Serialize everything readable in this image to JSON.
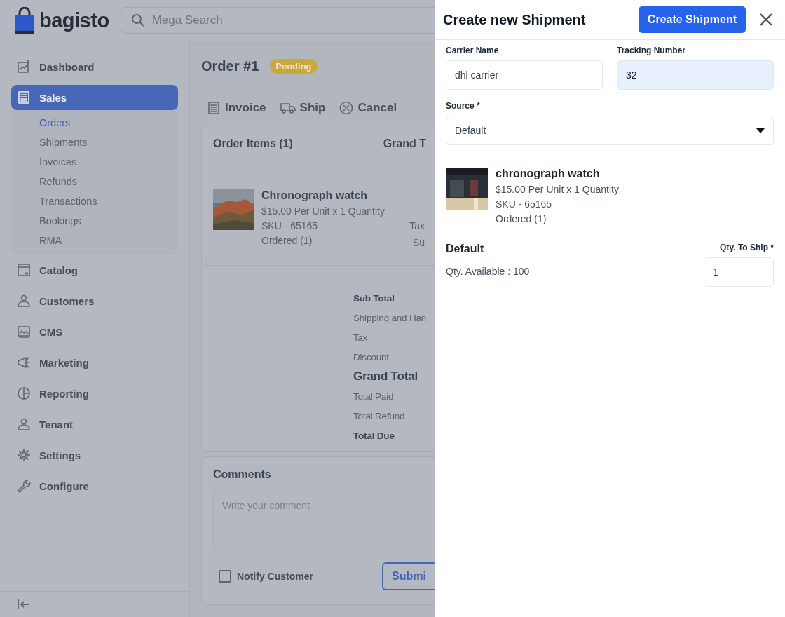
{
  "header": {
    "logo": "bagisto",
    "search": {
      "placeholder": "Mega Search"
    }
  },
  "sidebar": {
    "items": [
      {
        "label": "Dashboard",
        "selected": false
      },
      {
        "label": "Sales",
        "selected": true,
        "expanded": true,
        "children": [
          {
            "label": "Orders",
            "selected": true
          },
          {
            "label": "Shipments",
            "selected": false
          },
          {
            "label": "Invoices",
            "selected": false
          },
          {
            "label": "Refunds",
            "selected": false
          },
          {
            "label": "Transactions",
            "selected": false
          },
          {
            "label": "Bookings",
            "selected": false
          },
          {
            "label": "RMA",
            "selected": false
          }
        ]
      },
      {
        "label": "Catalog",
        "selected": false
      },
      {
        "label": "Customers",
        "selected": false
      },
      {
        "label": "CMS",
        "selected": false
      },
      {
        "label": "Marketing",
        "selected": false
      },
      {
        "label": "Reporting",
        "selected": false
      },
      {
        "label": "Tenant",
        "selected": false
      },
      {
        "label": "Settings",
        "selected": false
      },
      {
        "label": "Configure",
        "selected": false
      }
    ]
  },
  "order": {
    "title": "Order #1",
    "status": "Pending",
    "actions": [
      {
        "label": "Invoice"
      },
      {
        "label": "Ship"
      },
      {
        "label": "Cancel"
      }
    ],
    "items_card": {
      "title": "Order Items (1)",
      "grand_total_heading": "Grand T",
      "item": {
        "name": "Chronograph watch",
        "price": "$15.00 Per Unit x 1 Quantity",
        "sku": "SKU - 65165",
        "ordered": "Ordered (1)"
      },
      "side_labels": [
        "Tax",
        "Su"
      ]
    },
    "totals": [
      {
        "label": "Sub Total",
        "kind": "bold"
      },
      {
        "label": "Shipping and Han",
        "kind": "plain"
      },
      {
        "label": "Tax",
        "kind": "plain"
      },
      {
        "label": "Discount",
        "kind": "plain"
      },
      {
        "label": "Grand Total",
        "kind": "large"
      },
      {
        "label": "Total Paid",
        "kind": "plain"
      },
      {
        "label": "Total Refund",
        "kind": "plain"
      },
      {
        "label": "Total Due",
        "kind": "bold"
      }
    ],
    "comments": {
      "title": "Comments",
      "placeholder": "Write your comment",
      "notify": {
        "label": "Notify Customer",
        "checked": false
      },
      "submit": "Submi"
    }
  },
  "shipment_panel": {
    "title": "Create new Shipment",
    "create_button": "Create Shipment",
    "fields": [
      {
        "label": "Carrier Name",
        "value": "dhl carrier",
        "autofilled": false
      },
      {
        "label": "Tracking Number",
        "value": "32",
        "autofilled": true
      }
    ],
    "source": {
      "label": "Source *",
      "value": "Default"
    },
    "item": {
      "name": "chronograph watch",
      "price": "$15.00 Per Unit x 1 Quantity",
      "sku": "SKU - 65165",
      "ordered": "Ordered (1)"
    },
    "inventory": {
      "source_name": "Default",
      "available": "Qty. Available : 100",
      "qty_label": "Qty. To Ship *",
      "qty_value": "1"
    }
  }
}
